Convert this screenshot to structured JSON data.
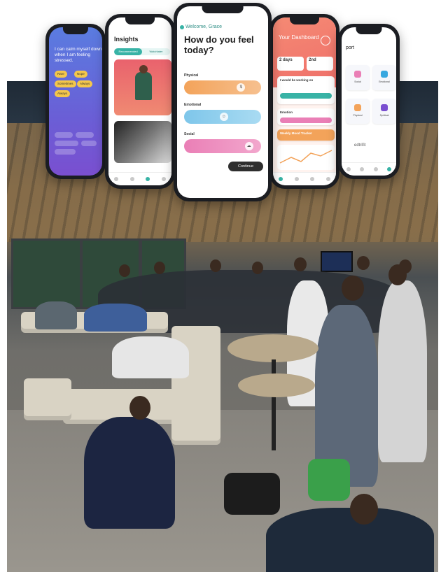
{
  "phones": {
    "purple": {
      "text": "I can calm myself down when I am feeling stressed.",
      "chips": [
        "Rare",
        "Nope",
        "Sometimes",
        "Always",
        "Always"
      ]
    },
    "insights": {
      "title": "Insights",
      "toggle": [
        "Recommended",
        "Watchlater"
      ]
    },
    "checkin": {
      "welcome": "Welcome, Grace",
      "question": "How do you feel today?",
      "sliders": [
        {
          "label": "Physical",
          "level": 0.78,
          "thumb": "$"
        },
        {
          "label": "Emotional",
          "level": 0.52,
          "thumb": "☺"
        },
        {
          "label": "Social",
          "level": 0.9,
          "thumb": "☁"
        }
      ],
      "continue_label": "Continue"
    },
    "dashboard": {
      "title": "Your Dashboard",
      "stats": [
        {
          "value": "2 days"
        },
        {
          "value": "2nd"
        }
      ],
      "working_label": "I would be working on",
      "emotion_label": "Emotion",
      "feeling_label": "Weekly Mood Tracker"
    },
    "report": {
      "title": "port",
      "tiles": [
        "Social",
        "Emotional",
        "Physical",
        "Spiritual"
      ],
      "logo": "edtrifit"
    }
  },
  "colors": {
    "teal": "#38b3a6",
    "purple": "#6a5fd6",
    "coral": "#ef6f6a",
    "orange": "#f3a35a",
    "blue": "#7ec6ea",
    "pink": "#ea7fb6"
  }
}
